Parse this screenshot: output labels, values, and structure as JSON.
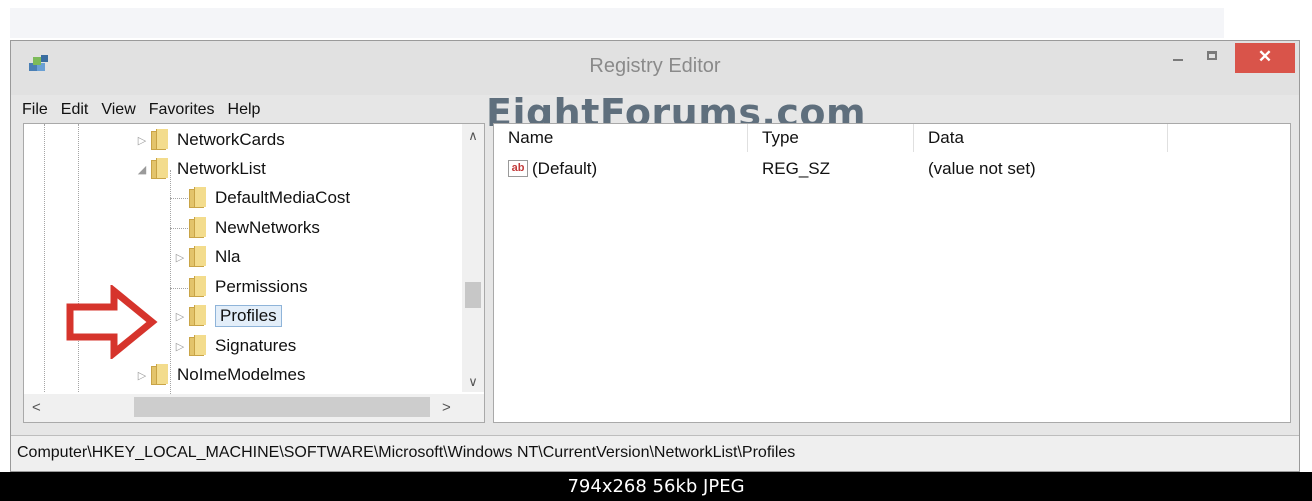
{
  "window": {
    "title": "Registry Editor",
    "close_glyph": "✕"
  },
  "menu": [
    "File",
    "Edit",
    "View",
    "Favorites",
    "Help"
  ],
  "watermark": "EightForums.com",
  "tree": [
    {
      "label": "NetworkCards",
      "expander": "▷"
    },
    {
      "label": "NetworkList",
      "expander": "◢"
    },
    {
      "label": "DefaultMediaCost",
      "expander": ""
    },
    {
      "label": "NewNetworks",
      "expander": ""
    },
    {
      "label": "Nla",
      "expander": "▷"
    },
    {
      "label": "Permissions",
      "expander": ""
    },
    {
      "label": "Profiles",
      "expander": "▷"
    },
    {
      "label": "Signatures",
      "expander": "▷"
    },
    {
      "label": "NoImeModelmes",
      "expander": "▷"
    }
  ],
  "columns": [
    "Name",
    "Type",
    "Data"
  ],
  "values": [
    {
      "icon": "ab",
      "name": "(Default)",
      "type": "REG_SZ",
      "data": "(value not set)"
    }
  ],
  "status_path": "Computer\\HKEY_LOCAL_MACHINE\\SOFTWARE\\Microsoft\\Windows NT\\CurrentVersion\\NetworkList\\Profiles",
  "footer": "794x268  56kb  JPEG",
  "icons": {
    "app": "registry-editor-icon",
    "folder": "folder-icon",
    "string_value": "string-value-icon",
    "pointer": "red-arrow-icon"
  },
  "colors": {
    "close_button": "#d9544a",
    "selection_border": "#8fb4d9",
    "pointer_arrow": "#d6342c",
    "folder": "#e3c46b"
  }
}
